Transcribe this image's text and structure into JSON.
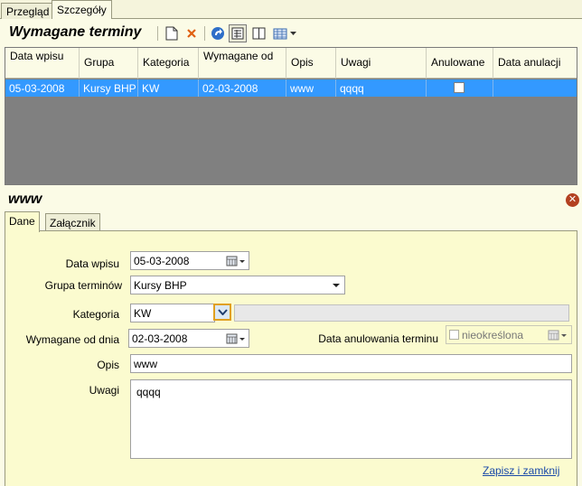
{
  "tabs": [
    {
      "label": "Przegląd",
      "active": false
    },
    {
      "label": "Szczegóły",
      "active": true
    }
  ],
  "section": {
    "title": "Wymagane terminy",
    "toolbar": [
      "new-document-icon",
      "delete-icon",
      "refresh-icon",
      "calculator-icon",
      "split-view-icon",
      "table-view-icon"
    ]
  },
  "grid": {
    "columns": [
      "Data wpisu",
      "Grupa",
      "Kategoria",
      "Wymagane od",
      "Opis",
      "Uwagi",
      "Anulowane",
      "Data anulacji"
    ],
    "rows": [
      {
        "data_wpisu": "05-03-2008",
        "grupa": "Kursy BHP",
        "kategoria": "KW",
        "wymagane_od": "02-03-2008",
        "opis": "www",
        "uwagi": "qqqq",
        "anulowane": false,
        "data_anulacji": ""
      }
    ],
    "selected_color": "#3399ff"
  },
  "detail": {
    "title": "www",
    "tabs": [
      {
        "label": "Dane",
        "active": true
      },
      {
        "label": "Załącznik",
        "active": false
      }
    ],
    "form": {
      "data_wpisu_label": "Data wpisu",
      "data_wpisu_value": "05-03-2008",
      "grupa_label": "Grupa terminów",
      "grupa_value": "Kursy BHP",
      "kategoria_label": "Kategoria",
      "kategoria_value": "KW",
      "kategoria_extra": "",
      "wymagane_label": "Wymagane od dnia",
      "wymagane_value": "02-03-2008",
      "anulowanie_label": "Data anulowania terminu",
      "anulowanie_value": "nieokreślona",
      "opis_label": "Opis",
      "opis_value": "www",
      "uwagi_label": "Uwagi",
      "uwagi_value": "qqqq"
    },
    "save_link": "Zapisz i zamknij"
  }
}
